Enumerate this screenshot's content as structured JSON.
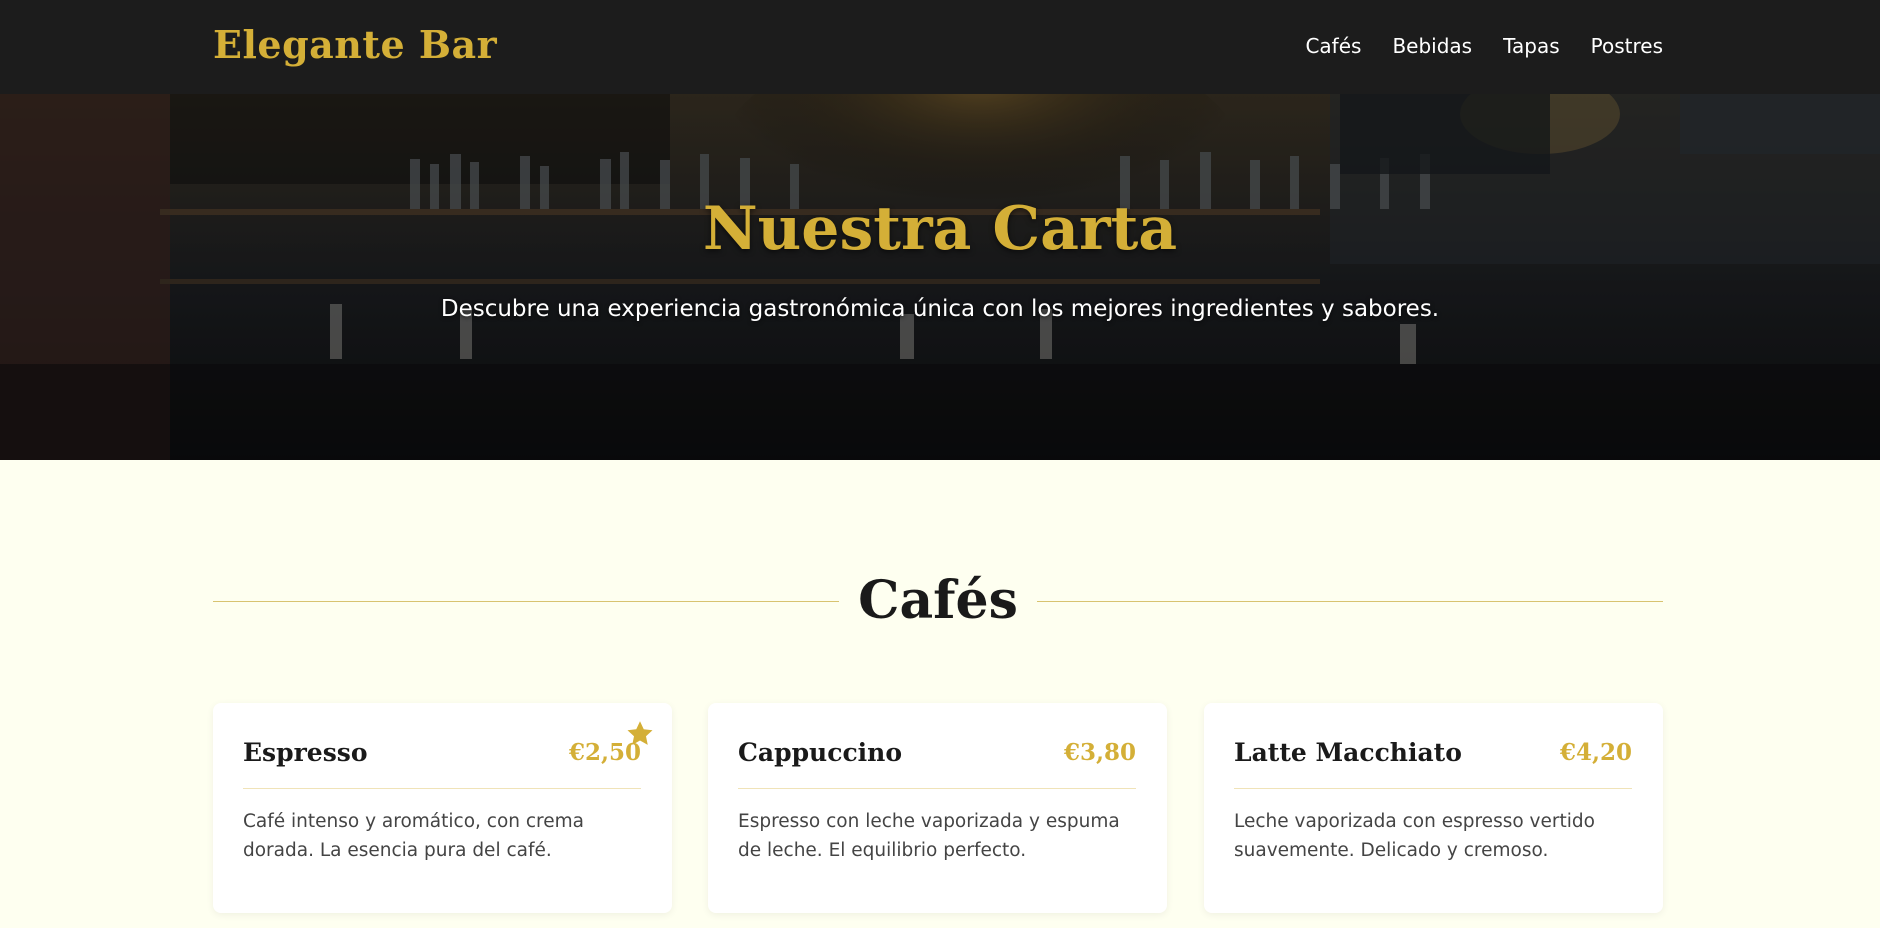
{
  "header": {
    "brand": "Elegante Bar",
    "nav": [
      "Cafés",
      "Bebidas",
      "Tapas",
      "Postres"
    ]
  },
  "hero": {
    "title": "Nuestra Carta",
    "subtitle": "Descubre una experiencia gastronómica única con los mejores ingredientes y sabores."
  },
  "section": {
    "title": "Cafés"
  },
  "items": [
    {
      "name": "Espresso",
      "price": "€2,50",
      "description": "Café intenso y aromático, con crema dorada. La esencia pura del café.",
      "featured": true
    },
    {
      "name": "Cappuccino",
      "price": "€3,80",
      "description": "Espresso con leche vaporizada y espuma de leche. El equilibrio perfecto.",
      "featured": false
    },
    {
      "name": "Latte Macchiato",
      "price": "€4,20",
      "description": "Leche vaporizada con espresso vertido suavemente. Delicado y cremoso.",
      "featured": false
    }
  ],
  "colors": {
    "accent": "#d4af37",
    "header_bg": "#1c1c1c",
    "page_bg": "#fefff0"
  },
  "icons": {
    "featured": "star-icon"
  }
}
